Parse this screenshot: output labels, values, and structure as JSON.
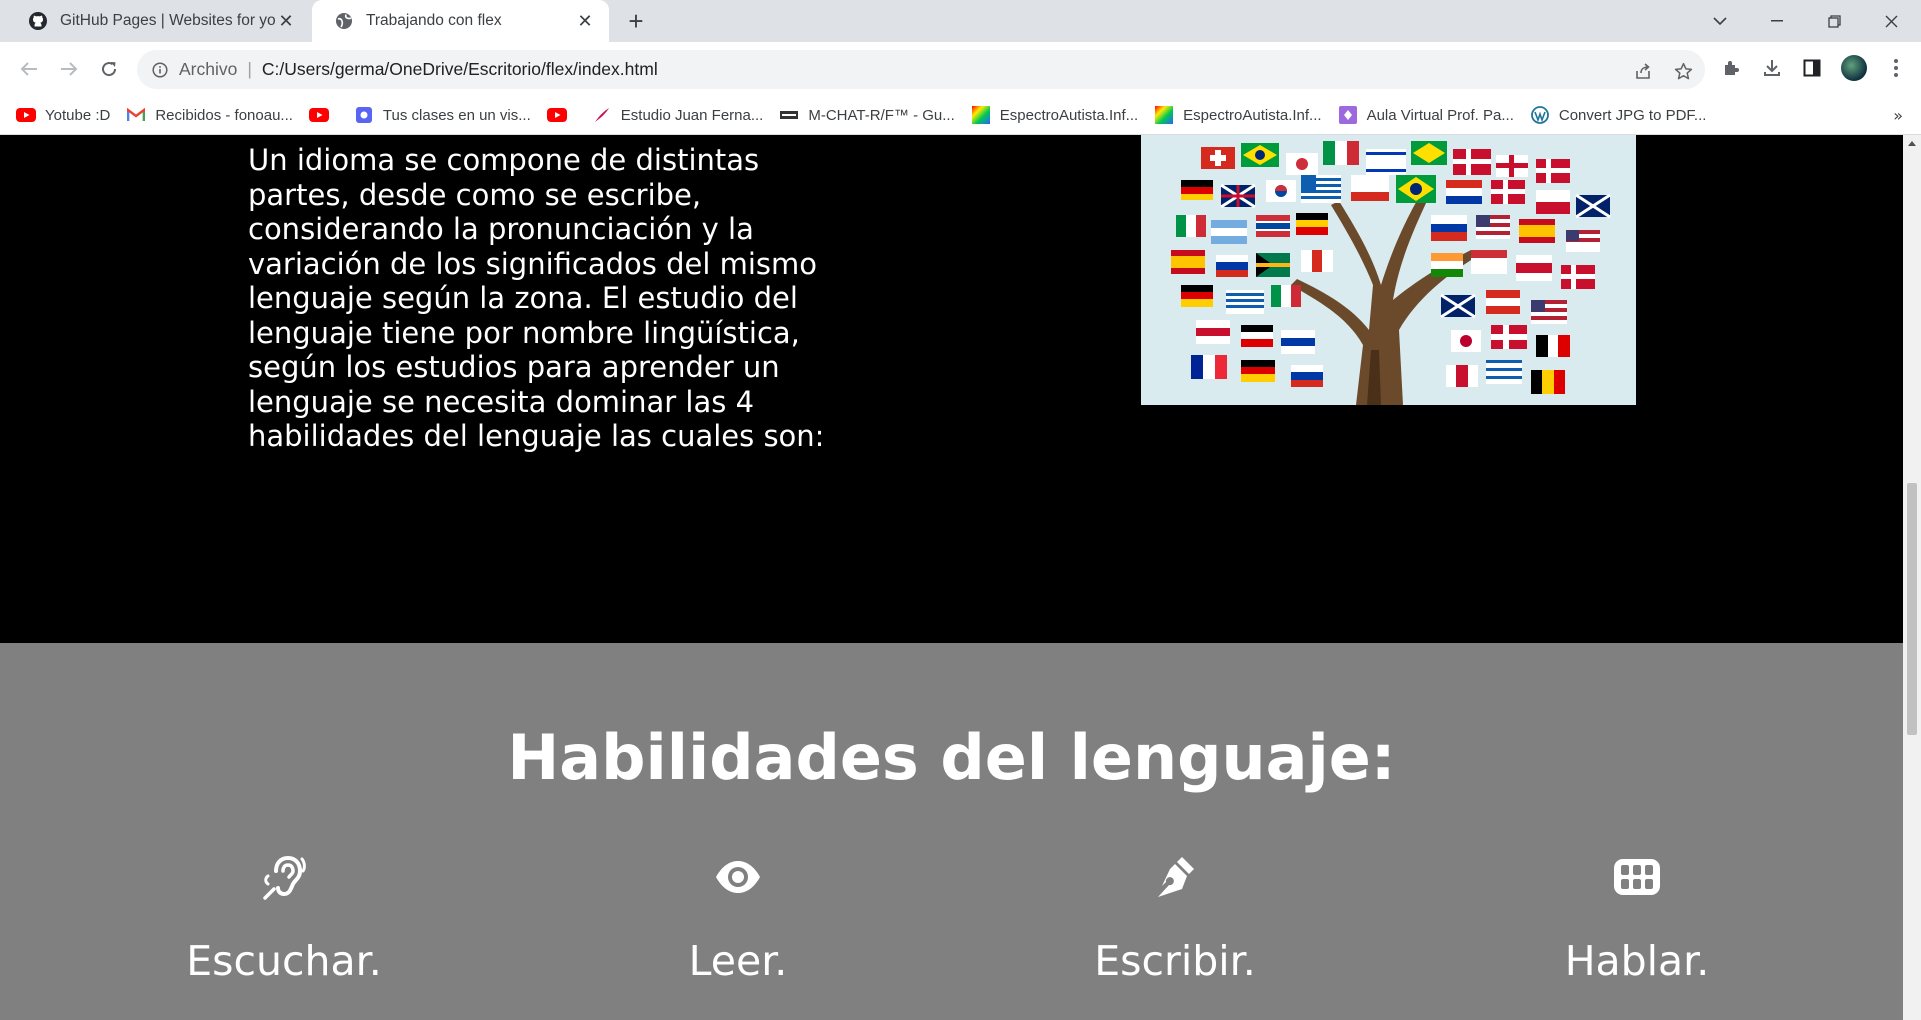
{
  "browser": {
    "tabs": [
      {
        "title": "GitHub Pages | Websites for you",
        "icon": "github-icon",
        "active": false
      },
      {
        "title": "Trabajando con flex",
        "icon": "globe-icon",
        "active": true
      }
    ],
    "address": {
      "scheme_label": "Archivo",
      "url": "C:/Users/germa/OneDrive/Escritorio/flex/index.html"
    },
    "bookmarks": [
      {
        "label": "Yotube :D",
        "icon": "youtube-icon"
      },
      {
        "label": "Recibidos - fonoau...",
        "icon": "gmail-icon"
      },
      {
        "label": "",
        "icon": "youtube-icon"
      },
      {
        "label": "Tus clases en un vis...",
        "icon": "app-icon"
      },
      {
        "label": "",
        "icon": "youtube-icon"
      },
      {
        "label": "Estudio Juan Ferna...",
        "icon": "feather-icon"
      },
      {
        "label": "M-CHAT-R/F™ - Gu...",
        "icon": "mchat-icon"
      },
      {
        "label": "EspectroAutista.Inf...",
        "icon": "rainbow-icon"
      },
      {
        "label": "EspectroAutista.Inf...",
        "icon": "rainbow-icon"
      },
      {
        "label": "Aula Virtual Prof. Pa...",
        "icon": "diamond-icon"
      },
      {
        "label": "Convert JPG to PDF...",
        "icon": "wordpress-icon"
      }
    ],
    "more_bookmarks": "»"
  },
  "page": {
    "intro_paragraph": "Un idioma se compone de distintas partes, desde como se escribe, considerando la pronunciación y la variación de los significados del mismo lenguaje según la zona. El estudio del lenguaje tiene por nombre lingüística, según los estudios para aprender un lenguaje se necesita dominar las 4 habilidades del lenguaje las cuales son:",
    "image_icon": "flag-tree-image",
    "skills_heading": "Habilidades del lenguaje:",
    "skills": [
      {
        "label": "Escuchar.",
        "icon": "listening-ear-icon"
      },
      {
        "label": "Leer.",
        "icon": "eye-icon"
      },
      {
        "label": "Escribir.",
        "icon": "pen-nib-icon"
      },
      {
        "label": "Hablar.",
        "icon": "teeth-icon"
      }
    ]
  },
  "colors": {
    "top_section_bg": "#000000",
    "skills_section_bg": "#808080",
    "text": "#ffffff",
    "tab_strip": "#dee1e6"
  }
}
